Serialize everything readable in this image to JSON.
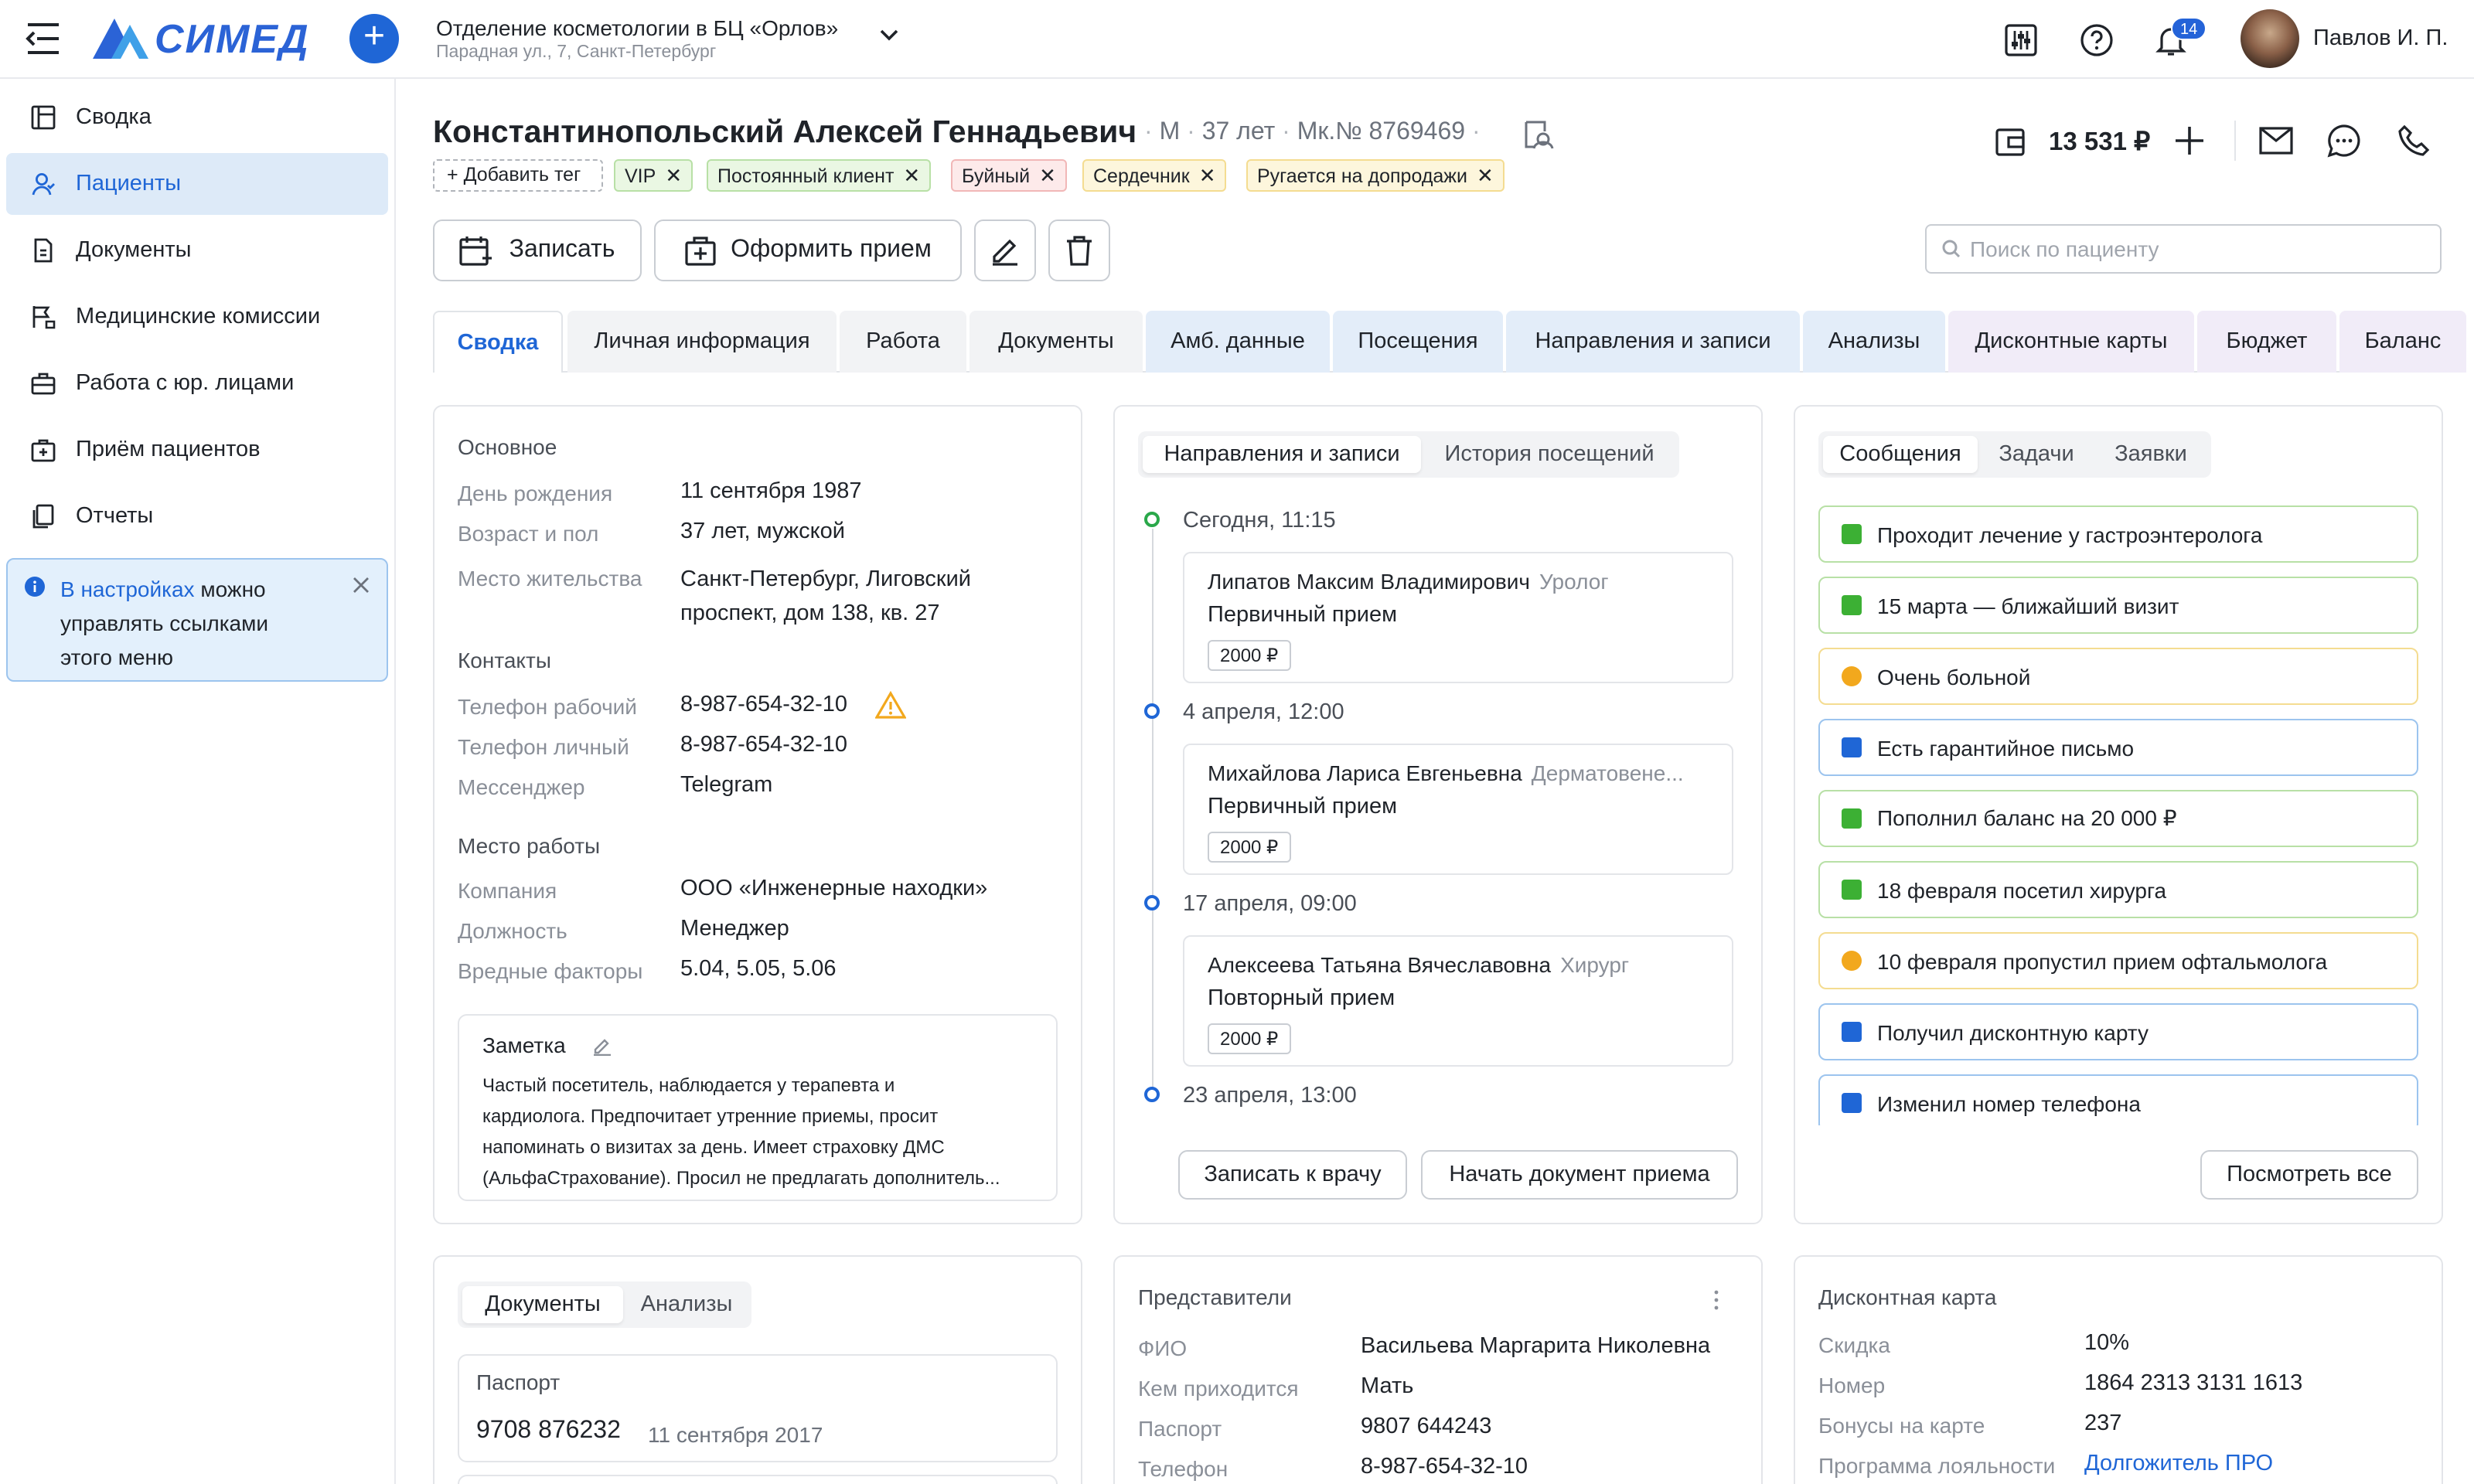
{
  "header": {
    "logo_text": "СИМЕД",
    "department": "Отделение косметологии в БЦ «Орлов»",
    "address": "Парадная ул., 7, Санкт-Петербург",
    "notifications_count": "14",
    "user_name": "Павлов И. П."
  },
  "sidebar": {
    "items": [
      {
        "label": "Сводка",
        "icon": "summary-icon"
      },
      {
        "label": "Пациенты",
        "icon": "patients-icon"
      },
      {
        "label": "Документы",
        "icon": "documents-icon"
      },
      {
        "label": "Медицинские комиссии",
        "icon": "commission-icon"
      },
      {
        "label": "Работа с юр. лицами",
        "icon": "briefcase-icon"
      },
      {
        "label": "Приём пациентов",
        "icon": "medkit-icon"
      },
      {
        "label": "Отчеты",
        "icon": "reports-icon"
      }
    ],
    "info_link": "В настройках",
    "info_line1": "можно",
    "info_line2": "управлять ссылками",
    "info_line3": "этого меню"
  },
  "patient": {
    "name": "Константинопольский Алексей Геннадьевич",
    "sex": "М",
    "age": "37 лет",
    "card_number": "Мк.№ 8769469",
    "balance": "13 531 ₽",
    "add_tag": "Добавить тег",
    "tags": [
      {
        "label": "VIP",
        "color": "green"
      },
      {
        "label": "Постоянный клиент",
        "color": "green"
      },
      {
        "label": "Буйный",
        "color": "red"
      },
      {
        "label": "Сердечник",
        "color": "yellow"
      },
      {
        "label": "Ругается на допродажи",
        "color": "yellow"
      }
    ]
  },
  "actions": {
    "book": "Записать",
    "make_appointment": "Оформить прием",
    "search_placeholder": "Поиск по пациенту"
  },
  "tabs": [
    {
      "label": "Сводка",
      "style": "active"
    },
    {
      "label": "Личная информация",
      "style": "gray"
    },
    {
      "label": "Работа",
      "style": "gray"
    },
    {
      "label": "Документы",
      "style": "gray"
    },
    {
      "label": "Амб. данные",
      "style": "blue"
    },
    {
      "label": "Посещения",
      "style": "blue"
    },
    {
      "label": "Направления и записи",
      "style": "blue"
    },
    {
      "label": "Анализы",
      "style": "blue"
    },
    {
      "label": "Дисконтные карты",
      "style": "purple"
    },
    {
      "label": "Бюджет",
      "style": "purple"
    },
    {
      "label": "Баланс",
      "style": "purple"
    }
  ],
  "basic": {
    "title": "Основное",
    "birthday_label": "День рождения",
    "birthday": "11 сентября 1987",
    "age_sex_label": "Возраст и пол",
    "age_sex": "37 лет, мужской",
    "residence_label": "Место жительства",
    "residence_1": "Санкт-Петербург, Лиговский",
    "residence_2": "проспект, дом 138, кв. 27",
    "contacts_title": "Контакты",
    "work_phone_label": "Телефон рабочий",
    "work_phone": "8-987-654-32-10",
    "personal_phone_label": "Телефон личный",
    "personal_phone": "8-987-654-32-10",
    "messenger_label": "Мессенджер",
    "messenger": "Telegram",
    "work_title": "Место работы",
    "company_label": "Компания",
    "company": "ООО «Инженерные находки»",
    "position_label": "Должность",
    "position": "Менеджер",
    "hazards_label": "Вредные факторы",
    "hazards": "5.04, 5.05, 5.06",
    "note_title": "Заметка",
    "note_1": "Частый посетитель, наблюдается у терапевта и",
    "note_2": "кардиолога. Предпочитает утренние приемы, просит",
    "note_3": "напоминать о визитах за день. Имеет страховку ДМС",
    "note_4": "(АльфаСтрахование). Просил не предлагать дополнитель..."
  },
  "visits": {
    "tab_active": "Направления и записи",
    "tab_other": "История посещений",
    "items": [
      {
        "date": "Сегодня, 11:15",
        "doctor": "Липатов Максим Владимирович",
        "specialty": "Уролог",
        "type": "Первичный прием",
        "price": "2000 ₽"
      },
      {
        "date": "4 апреля, 12:00",
        "doctor": "Михайлова Лариса Евгеньевна",
        "specialty": "Дерматовене...",
        "type": "Первичный прием",
        "price": "2000 ₽"
      },
      {
        "date": "17 апреля, 09:00",
        "doctor": "Алексеева Татьяна Вячеславовна",
        "specialty": "Хирург",
        "type": "Повторный прием",
        "price": "2000 ₽"
      }
    ],
    "last_date": "23 апреля, 13:00",
    "book_doctor": "Записать к врачу",
    "start_doc": "Начать документ приема"
  },
  "messages": {
    "tabs": [
      "Сообщения",
      "Задачи",
      "Заявки"
    ],
    "items": [
      {
        "text": "Проходит лечение у гастроэнтеролога",
        "color": "green"
      },
      {
        "text": "15 марта — ближайший визит",
        "color": "green"
      },
      {
        "text": "Очень больной",
        "color": "yellow"
      },
      {
        "text": "Есть гарантийное письмо",
        "color": "blue"
      },
      {
        "text": "Пополнил баланс на 20 000 ₽",
        "color": "green"
      },
      {
        "text": "18 февраля посетил хирурга",
        "color": "green"
      },
      {
        "text": "10 февраля пропустил прием офтальмолога",
        "color": "yellow"
      },
      {
        "text": "Получил дисконтную карту",
        "color": "blue"
      },
      {
        "text": "Изменил номер телефона",
        "color": "blue"
      }
    ],
    "view_all": "Посмотреть все"
  },
  "docs": {
    "tab_active": "Документы",
    "tab_other": "Анализы",
    "passport_title": "Паспорт",
    "passport_number": "9708 876232",
    "passport_date": "11 сентября 2017"
  },
  "reps": {
    "title": "Представители",
    "fio_label": "ФИО",
    "fio": "Васильева Маргарита Николевна",
    "relation_label": "Кем приходится",
    "relation": "Мать",
    "passport_label": "Паспорт",
    "passport": "9807 644243",
    "phone_label": "Телефон",
    "phone": "8-987-654-32-10"
  },
  "discount": {
    "title": "Дисконтная карта",
    "discount_label": "Скидка",
    "discount": "10%",
    "number_label": "Номер",
    "number": "1864 2313 3131 1613",
    "bonus_label": "Бонусы на карте",
    "bonus": "237",
    "program_label": "Программа лояльности",
    "program": "Долгожитель ПРО"
  }
}
